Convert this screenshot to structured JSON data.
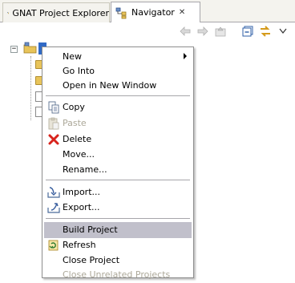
{
  "tabs": [
    {
      "label": "GNAT Project Explorer"
    },
    {
      "label": "Navigator",
      "close": "✕"
    }
  ],
  "toolbar": {
    "icons": [
      "back-arrow-icon",
      "forward-arrow-icon",
      "up-folder-icon",
      "collapse-all-icon",
      "link-with-editor-icon",
      "view-menu-icon"
    ]
  },
  "tree": {
    "expander": "−"
  },
  "context_menu": {
    "items": [
      {
        "label": "New",
        "submenu": true
      },
      {
        "label": "Go Into"
      },
      {
        "label": "Open in New Window"
      },
      {
        "label": "Copy"
      },
      {
        "label": "Paste",
        "disabled": true
      },
      {
        "label": "Delete"
      },
      {
        "label": "Move..."
      },
      {
        "label": "Rename..."
      },
      {
        "label": "Import..."
      },
      {
        "label": "Export..."
      },
      {
        "label": "Build Project",
        "highlighted": true
      },
      {
        "label": "Refresh"
      },
      {
        "label": "Close Project"
      },
      {
        "label": "Close Unrelated Projects",
        "disabled": true
      }
    ]
  },
  "colors": {
    "highlight": "#c1c0cb",
    "selection": "#316ac5",
    "disabled_text": "#aca899"
  }
}
